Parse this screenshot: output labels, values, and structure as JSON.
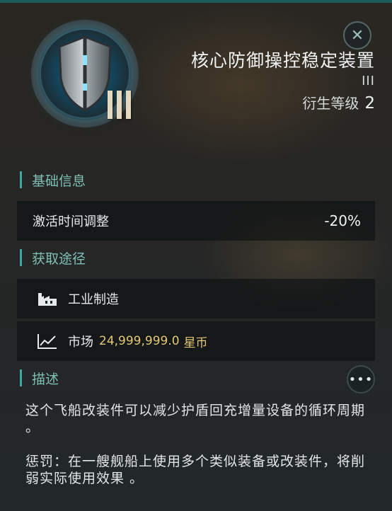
{
  "header": {
    "title": "核心防御操控稳定装置",
    "tier_text": "III",
    "derive_label": "衍生等级",
    "derive_level": "2",
    "close_icon": "close-icon",
    "emblem_icon": "shield-icon"
  },
  "basic": {
    "section_label": "基础信息",
    "rows": [
      {
        "label": "激活时间调整",
        "value": "-20%"
      }
    ]
  },
  "acquire": {
    "section_label": "获取途径",
    "items": [
      {
        "icon": "factory-icon",
        "label": "工业制造"
      },
      {
        "icon": "chart-icon",
        "label": "市场",
        "price": "24,999,999.0",
        "currency": "星币"
      }
    ]
  },
  "description": {
    "section_label": "描述",
    "more_icon": "more-icon",
    "text1": "这个飞船改装件可以减少护盾回充增量设备的循环周期 。",
    "text2": "惩罚：在一艘舰船上使用多个类似装备或改装件，将削弱实际使用效果 。"
  },
  "colors": {
    "accent": "#3fa9a1",
    "section_text": "#7fc0b6",
    "price": "#e7c774"
  }
}
